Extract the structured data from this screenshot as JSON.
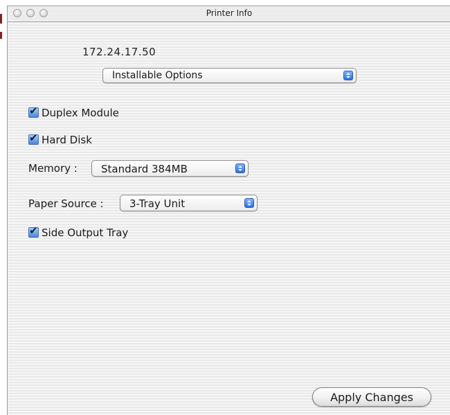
{
  "window": {
    "title": "Printer Info"
  },
  "printer": {
    "address": "172.24.17.50"
  },
  "view_selector": {
    "value": "Installable Options"
  },
  "options": {
    "duplex_module": {
      "label": "Duplex Module",
      "checked": true
    },
    "hard_disk": {
      "label": "Hard Disk",
      "checked": true
    },
    "memory": {
      "label": "Memory :",
      "value": "Standard 384MB"
    },
    "paper_source": {
      "label": "Paper Source :",
      "value": "3-Tray Unit"
    },
    "side_output_tray": {
      "label": "Side Output Tray",
      "checked": true
    }
  },
  "actions": {
    "apply_label": "Apply Changes"
  },
  "icons": {
    "window_controls": [
      "close-icon",
      "minimize-icon",
      "zoom-icon"
    ],
    "checkmark": "checkmark-icon",
    "popup_arrows": "popup-arrows-icon"
  },
  "colors": {
    "checkbox_accent": "#4a86db",
    "popup_accent": "#2f6fe0",
    "edge_mark": "#8a1f1f"
  }
}
